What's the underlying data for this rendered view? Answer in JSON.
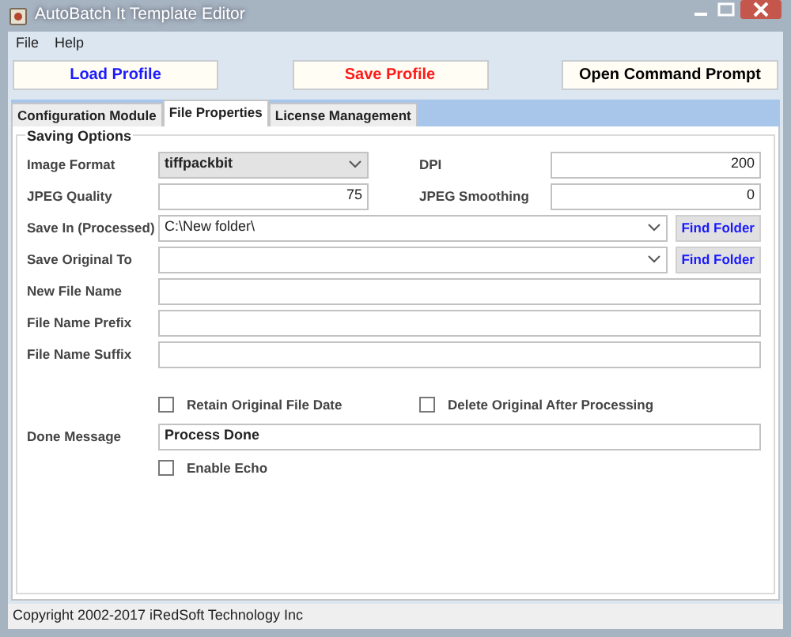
{
  "window": {
    "title": "AutoBatch It Template Editor"
  },
  "menu": [
    "File",
    "Help"
  ],
  "toolbar": [
    {
      "label": "Load Profile",
      "color": "#1a1aff"
    },
    {
      "label": "Save Profile",
      "color": "#ff1a1a"
    },
    {
      "label": "Open Command Prompt",
      "color": "#000000"
    }
  ],
  "tabs": [
    {
      "label": "Configuration Module",
      "selected": false
    },
    {
      "label": "File Properties",
      "selected": true
    },
    {
      "label": "License Management",
      "selected": false
    }
  ],
  "group": {
    "title": "Saving Options"
  },
  "rows": [
    {
      "kind": "pair",
      "cells": [
        {
          "label": "Image Format",
          "kind": "select",
          "value": "tiffpackbit",
          "bold": true
        },
        {
          "label": "DPI",
          "kind": "number",
          "value": "200"
        }
      ]
    },
    {
      "kind": "pair",
      "cells": [
        {
          "label": "JPEG Quality",
          "kind": "number",
          "value": "75"
        },
        {
          "label": "JPEG Smoothing",
          "kind": "number",
          "value": "0"
        }
      ]
    },
    {
      "kind": "combo",
      "label": "Save In (Processed)",
      "value": "C:\\New folder\\",
      "button": "Find Folder"
    },
    {
      "kind": "combo",
      "label": "Save Original To",
      "button": "Find Folder"
    },
    {
      "kind": "text",
      "label": "New File Name"
    },
    {
      "kind": "text",
      "label": "File Name Prefix"
    },
    {
      "kind": "text",
      "label": "File Name Suffix"
    },
    {
      "kind": "checks",
      "items": [
        {
          "label": "Retain Original File Date",
          "checked": false
        },
        {
          "label": "Delete Original After Processing",
          "checked": false
        }
      ]
    },
    {
      "kind": "text",
      "label": "Done Message",
      "value": "Process Done",
      "bold": true
    },
    {
      "kind": "checks",
      "items": [
        {
          "label": "Enable Echo",
          "checked": false
        }
      ]
    }
  ],
  "status_bar": "Copyright 2002-2017 iRedSoft Technology Inc"
}
